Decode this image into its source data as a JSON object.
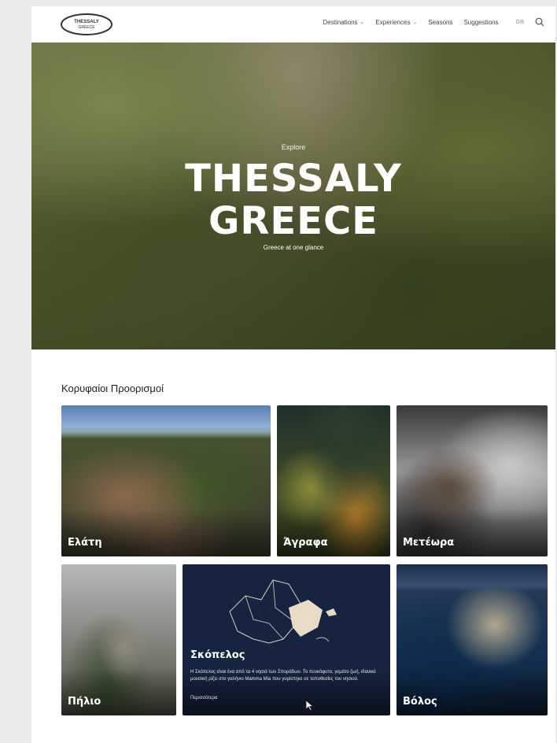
{
  "header": {
    "logo_text_top": "THESSALY",
    "logo_text_bottom": "GREECE",
    "nav": [
      "Destinations",
      "Experiences",
      "Seasons",
      "Suggestions"
    ],
    "lang": "GR"
  },
  "hero": {
    "eyebrow": "Explore",
    "title_line1": "THESSALY",
    "title_line2": "GREECE",
    "subtitle": "Greece at one glance"
  },
  "section": {
    "title": "Κορυφαίοι Προορισμοί",
    "cards": [
      {
        "label": "Ελάτη"
      },
      {
        "label": "Άγραφα"
      },
      {
        "label": "Μετέωρα"
      },
      {
        "label": "Πήλιο"
      },
      {
        "label": "Σκόπελος",
        "description": "Η Σκόπελος είναι ένα από τα 4 νησιά των Σποράδων. Το πευκόφυτο, γεμάτο ζωή, ιδανικό μουσική ρίζει στο γαλήνιο Mamma Mia που γυρίστηκε σε τοποθεσίες του νησιού.",
        "more": "Περισσότερα"
      },
      {
        "label": "Βόλος"
      }
    ]
  },
  "colors": {
    "page_bg": "#ececec",
    "sea": "#16243f",
    "land": "#e9dcc6"
  }
}
